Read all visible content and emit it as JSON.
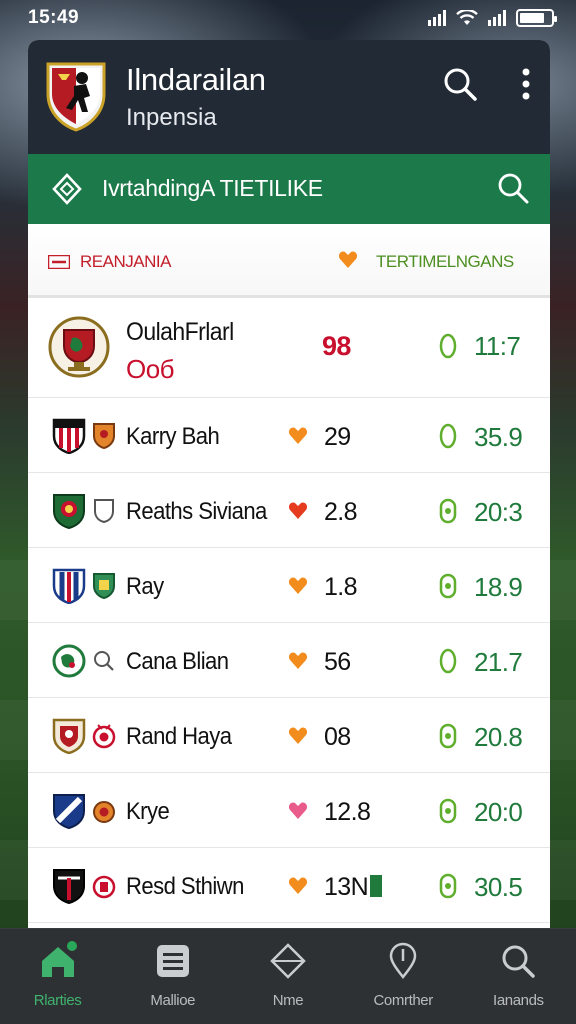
{
  "status_bar": {
    "time": "15:49"
  },
  "header": {
    "title": "Ilndarailan",
    "subtitle": "Inpensia"
  },
  "greenbar": {
    "title": "IvrtahdingA TIETILIKE"
  },
  "section": {
    "left_label": "REANJANIA",
    "right_label": "TERTIMELNGANS"
  },
  "featured": {
    "name": "OulahFrlarl",
    "sub": "Ooб",
    "mid": "98",
    "score": "11:7"
  },
  "rows": [
    {
      "name": "Karry Bah",
      "mid": "29",
      "score": "35.9",
      "heart_color": "#f28c1c"
    },
    {
      "name": "Reaths Siviana",
      "mid": "2.8",
      "score": "20:3",
      "heart_color": "#e53b1f"
    },
    {
      "name": "Ray",
      "mid": "1.8",
      "score": "18.9",
      "heart_color": "#f28c1c"
    },
    {
      "name": "Cana Blian",
      "mid": "56",
      "score": "21.7",
      "heart_color": "#f28c1c"
    },
    {
      "name": "Rand Haya",
      "mid": "08",
      "score": "20.8",
      "heart_color": "#f28c1c"
    },
    {
      "name": "Krye",
      "mid": "12.8",
      "score": "20:0",
      "heart_color": "#e85b8a"
    },
    {
      "name": "Resd Sthiwn",
      "mid": "13N",
      "score": "30.5",
      "heart_color": "#f28c1c"
    }
  ],
  "nav": {
    "items": [
      {
        "label": "Rlarties",
        "icon": "home-icon"
      },
      {
        "label": "Mallioe",
        "icon": "menu-icon"
      },
      {
        "label": "Nme",
        "icon": "pitch-icon"
      },
      {
        "label": "Comrther",
        "icon": "location-icon"
      },
      {
        "label": "Ianands",
        "icon": "search-icon"
      }
    ]
  },
  "colors": {
    "accent_green": "#1c7a4a",
    "header_dark": "#222a35",
    "alert_red": "#c8102e",
    "score_green": "#1f7a3c"
  }
}
